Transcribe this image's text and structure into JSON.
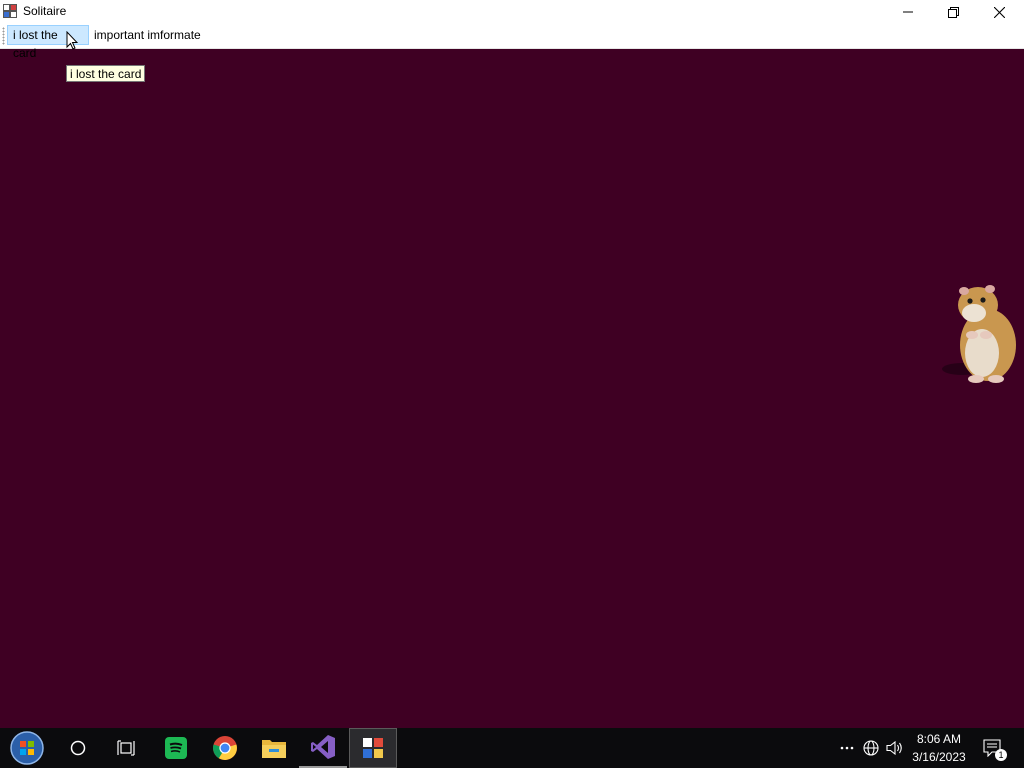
{
  "window": {
    "title": "Solitaire",
    "background_color": "#3f0023",
    "controls": [
      "minimize-icon",
      "restore-icon",
      "close-icon"
    ]
  },
  "menu": {
    "items": [
      {
        "label": "i lost the card",
        "state": "highlighted"
      },
      {
        "label": "important imformate"
      }
    ]
  },
  "tooltip": {
    "text": "i lost the card"
  },
  "taskbar": {
    "pinned": [
      "start-icon",
      "search-icon",
      "task-view-icon",
      "spotify-icon",
      "chrome-icon",
      "file-explorer-icon",
      "visual-studio-icon",
      "solitaire-app-icon"
    ],
    "tray": [
      "overflow-icon",
      "network-icon",
      "volume-icon",
      "notification-icon"
    ],
    "time": "8:06 AM",
    "date": "3/16/2023",
    "notification_count": "1"
  }
}
